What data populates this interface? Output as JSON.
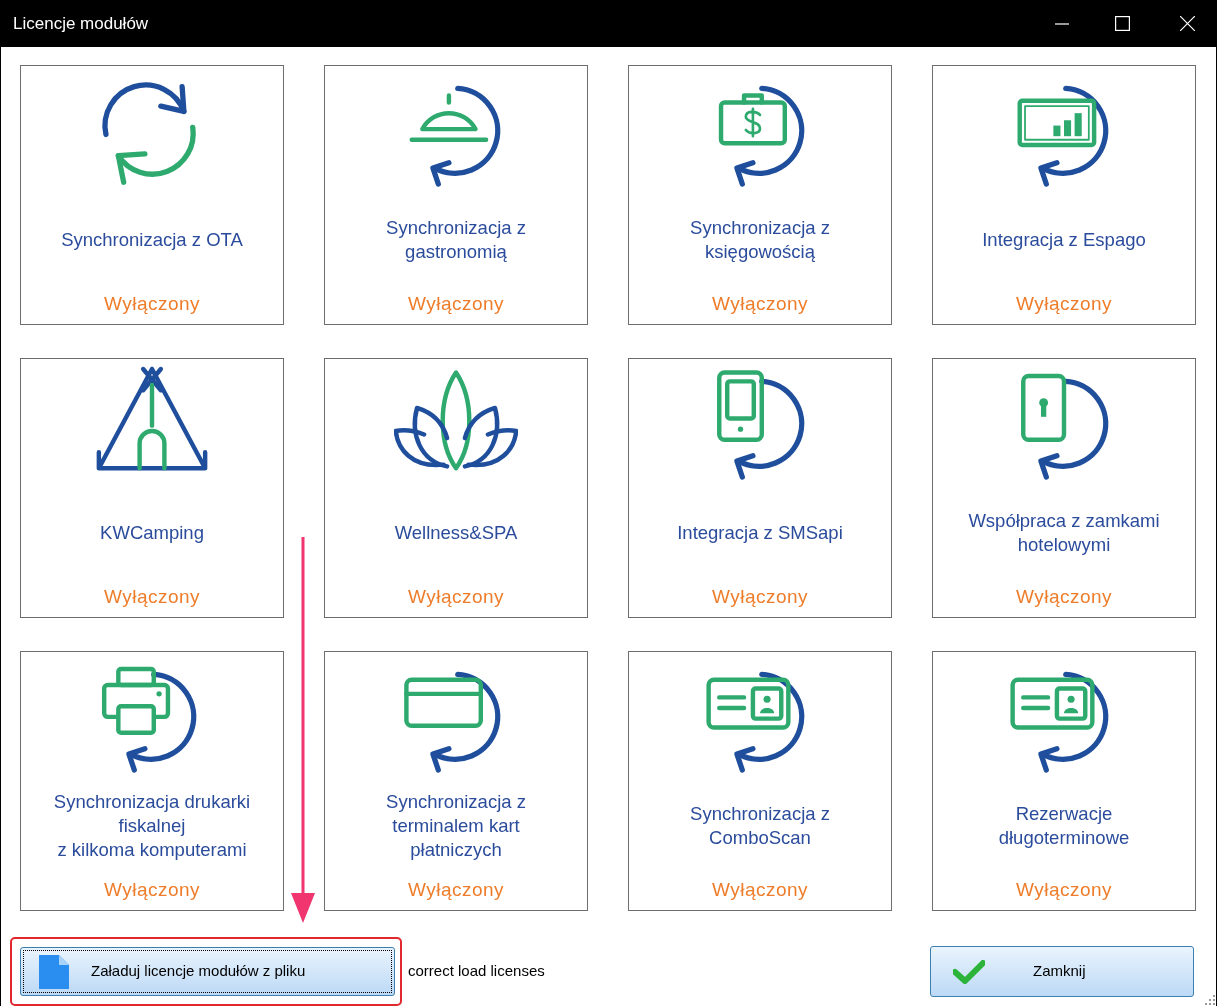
{
  "window": {
    "title": "Licencje modułów"
  },
  "modules": [
    {
      "kind": "sync",
      "title": "Synchronizacja z OTA",
      "status": "Wyłączony"
    },
    {
      "kind": "dome",
      "title": "Synchronizacja z\ngastronomią",
      "status": "Wyłączony"
    },
    {
      "kind": "money",
      "title": "Synchronizacja z\nksięgowością",
      "status": "Wyłączony"
    },
    {
      "kind": "chart",
      "title": "Integracja z Espago",
      "status": "Wyłączony"
    },
    {
      "kind": "tent",
      "title": "KWCamping",
      "status": "Wyłączony"
    },
    {
      "kind": "lotus",
      "title": "Wellness&SPA",
      "status": "Wyłączony"
    },
    {
      "kind": "phone",
      "title": "Integracja z SMSapi",
      "status": "Wyłączony"
    },
    {
      "kind": "keycard",
      "title": "Współpraca z zamkami\nhotelowymi",
      "status": "Wyłączony"
    },
    {
      "kind": "printer",
      "title": "Synchronizacja drukarki\nfiskalnej\nz kilkoma komputerami",
      "status": "Wyłączony"
    },
    {
      "kind": "card",
      "title": "Synchronizacja z\nterminalem kart\npłatniczych",
      "status": "Wyłączony"
    },
    {
      "kind": "idcard",
      "title": "Synchronizacja z\nComboScan",
      "status": "Wyłączony"
    },
    {
      "kind": "idcard",
      "title": "Rezerwacje\ndługoterminowe",
      "status": "Wyłączony"
    }
  ],
  "load_button": {
    "label": "Załaduj licencje modułów z pliku"
  },
  "message": "correct load licenses",
  "close_button": {
    "label": "Zamknij"
  }
}
